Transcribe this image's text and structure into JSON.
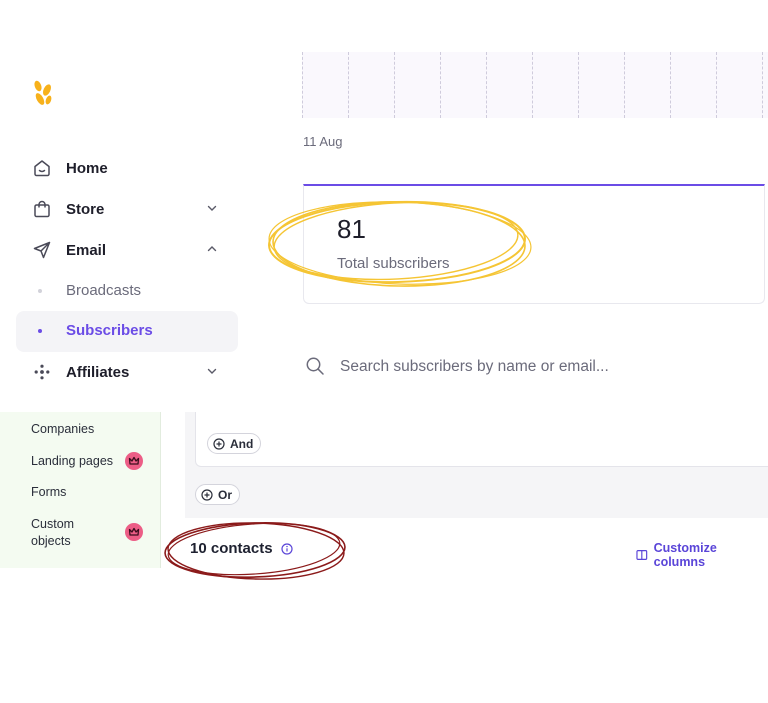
{
  "sidebar": {
    "items": [
      {
        "label": "Home",
        "icon": "home-icon"
      },
      {
        "label": "Store",
        "icon": "shopping-bag-icon"
      },
      {
        "label": "Email",
        "icon": "send-icon"
      },
      {
        "label": "Broadcasts"
      },
      {
        "label": "Subscribers"
      },
      {
        "label": "Affiliates",
        "icon": "affiliates-icon"
      }
    ]
  },
  "chart": {
    "date_label": "11 Aug"
  },
  "stats": {
    "value": "81",
    "caption": "Total subscribers"
  },
  "search": {
    "placeholder": "Search subscribers by name or email..."
  },
  "crm": {
    "sidebar_items": [
      "Companies",
      "Landing pages",
      "Forms",
      "Custom",
      "objects"
    ],
    "filter": {
      "and_label": "And",
      "or_label": "Or"
    },
    "contacts_label": "10 contacts",
    "customize_label": "Customize columns"
  },
  "colors": {
    "accent": "#6b4ce6",
    "highlight_yellow": "#f5c534",
    "highlight_red": "#8b1a1a",
    "premium_badge": "#ec5d86"
  }
}
